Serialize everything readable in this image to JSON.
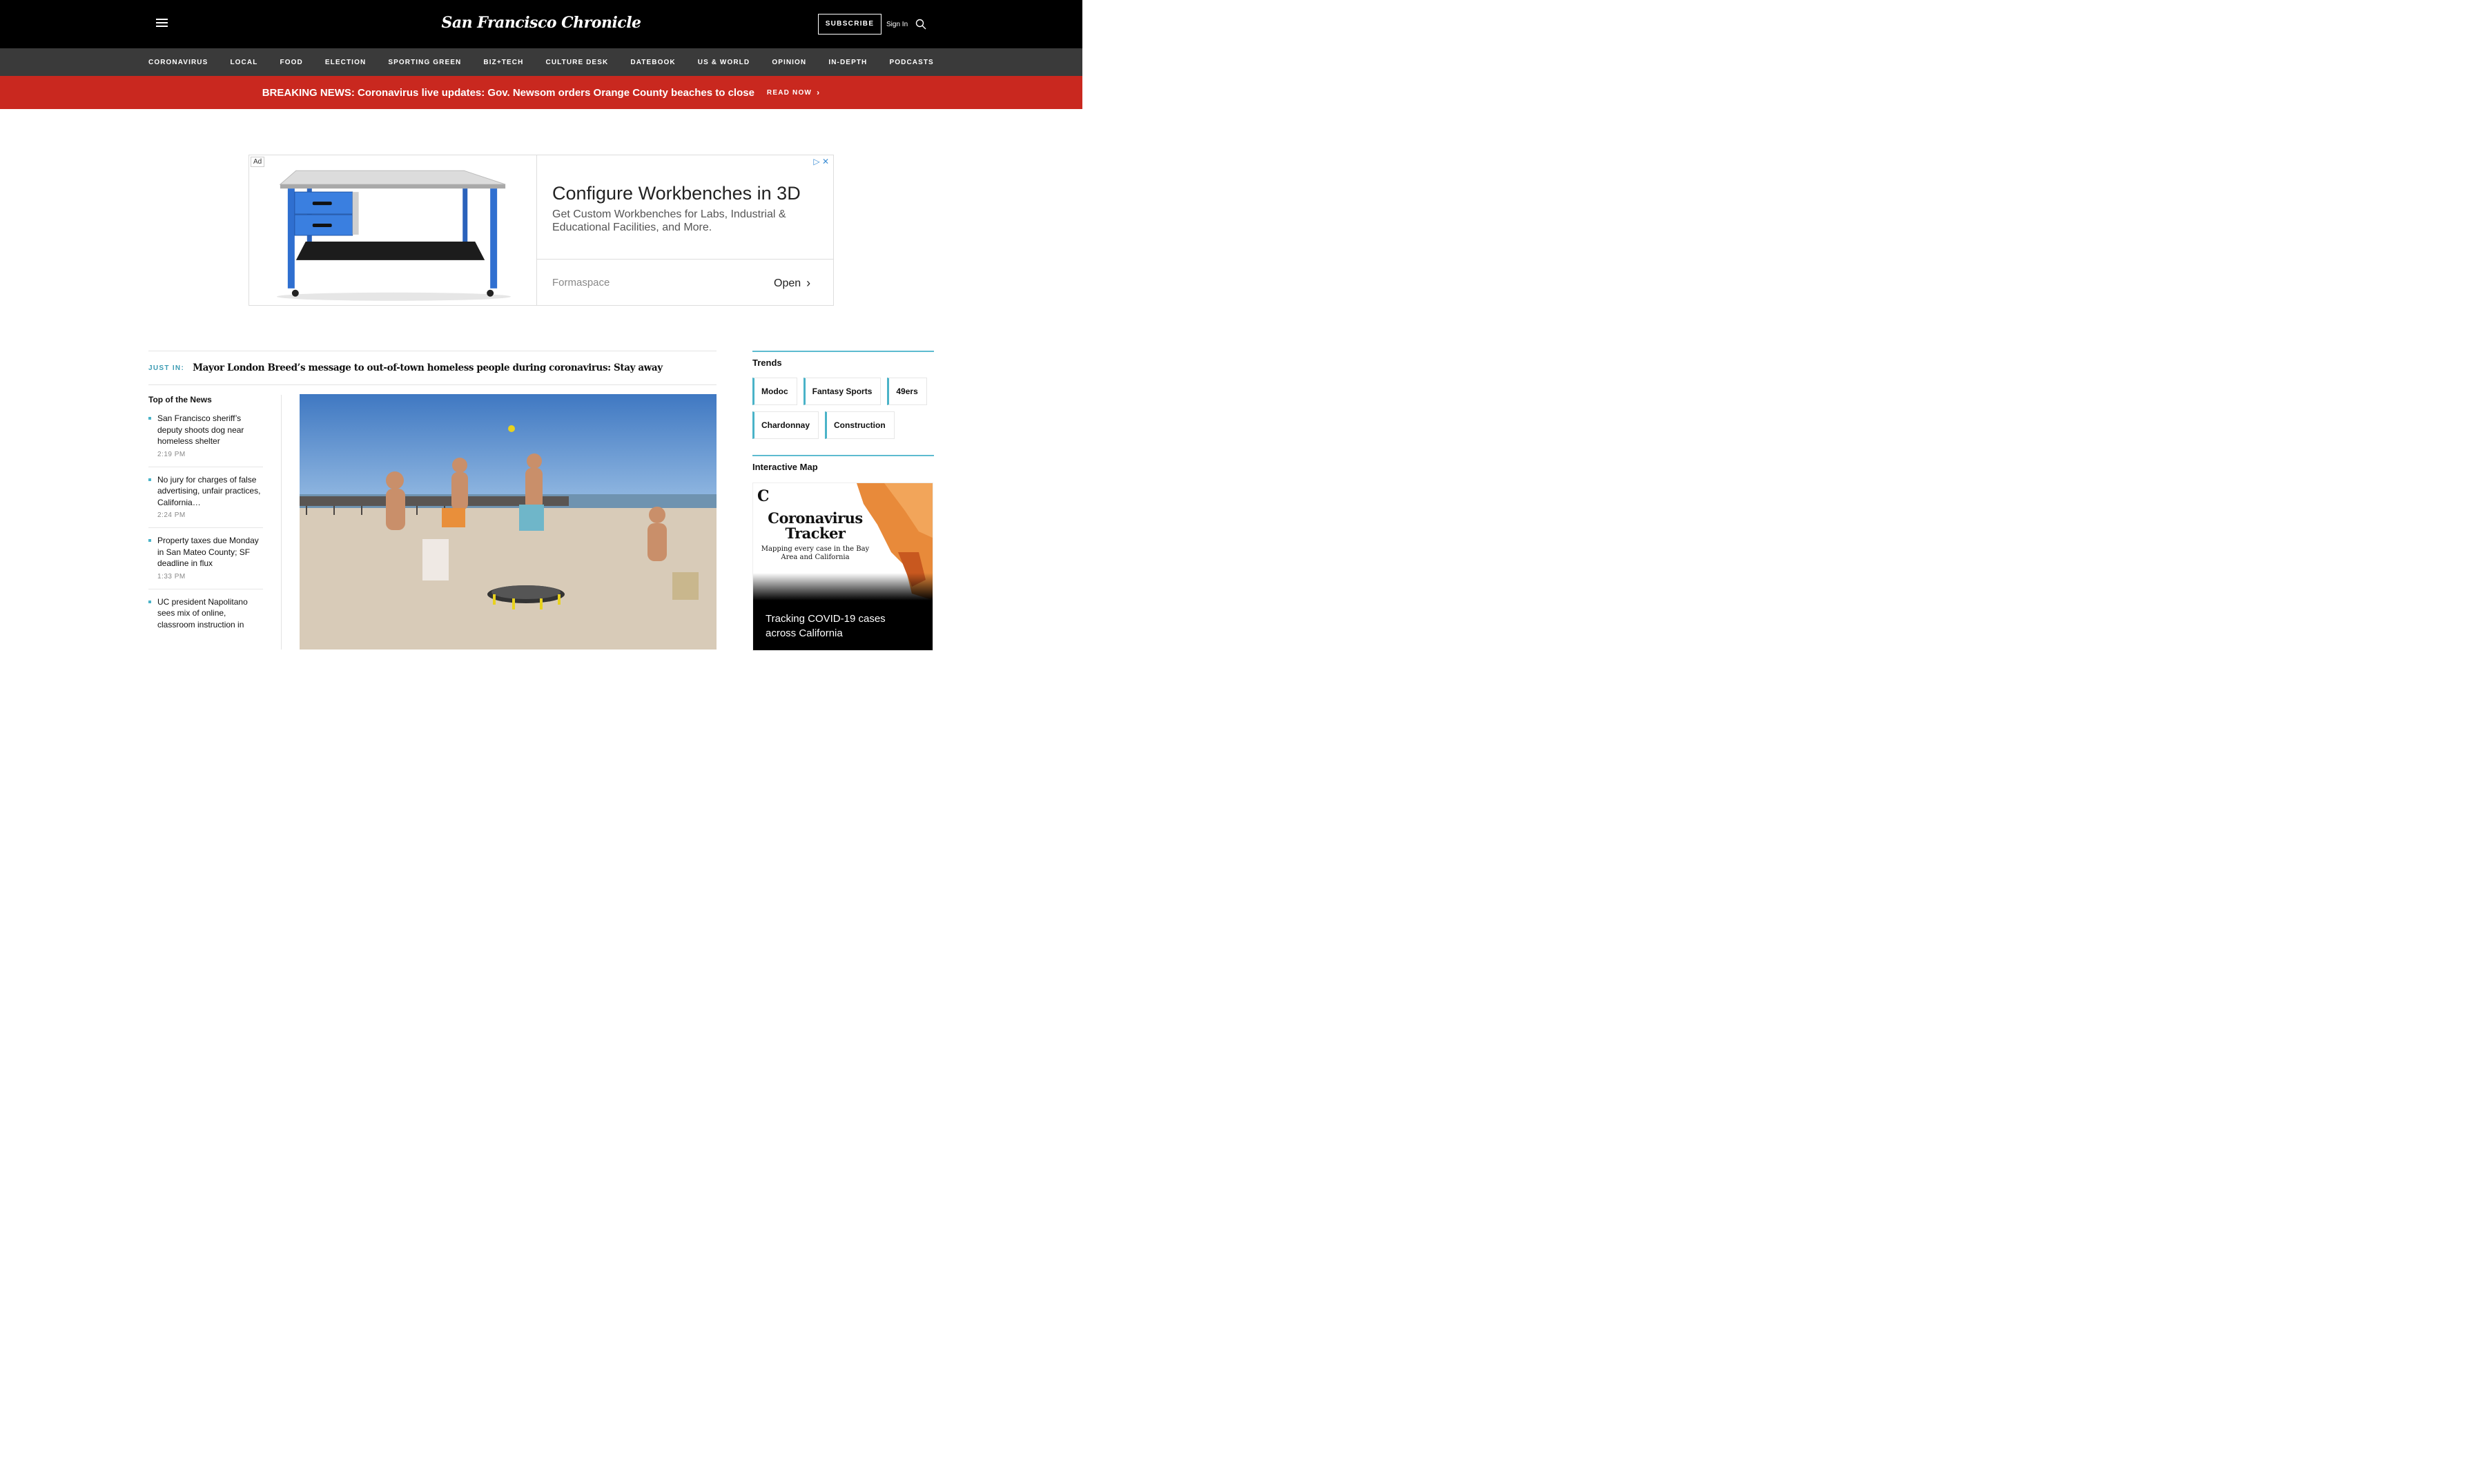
{
  "header": {
    "logo": "San Francisco Chronicle",
    "subscribe_label": "SUBSCRIBE",
    "signin_label": "Sign In",
    "icons": [
      "menu-icon",
      "search-icon"
    ]
  },
  "nav": {
    "items": [
      "CORONAVIRUS",
      "LOCAL",
      "FOOD",
      "ELECTION",
      "SPORTING GREEN",
      "BIZ+TECH",
      "CULTURE DESK",
      "DATEBOOK",
      "US & WORLD",
      "OPINION",
      "IN-DEPTH",
      "PODCASTS"
    ]
  },
  "breaking": {
    "headline": "BREAKING NEWS: Coronavirus live updates: Gov. Newsom orders Orange County beaches to close",
    "cta": "READ NOW"
  },
  "ad": {
    "badge": "Ad",
    "title": "Configure Workbenches in 3D",
    "description": "Get Custom Workbenches for Labs, Industrial & Educational Facilities, and More.",
    "brand": "Formaspace",
    "cta": "Open"
  },
  "just_in": {
    "label": "JUST IN:",
    "title": "Mayor London Breed’s message to out-of-town homeless people during coronavirus: Stay away"
  },
  "top_news": {
    "heading": "Top of the News",
    "items": [
      {
        "title": "San Francisco sheriff’s deputy shoots dog near homeless shelter",
        "time": "2:19 PM"
      },
      {
        "title": "No jury for charges of false advertising, unfair practices, California…",
        "time": "2:24 PM"
      },
      {
        "title": "Property taxes due Monday in San Mateo County; SF deadline in flux",
        "time": "1:33 PM"
      },
      {
        "title": "UC president Napolitano sees mix of online, classroom instruction in",
        "time": ""
      }
    ]
  },
  "trends": {
    "heading": "Trends",
    "items": [
      "Modoc",
      "Fantasy Sports",
      "49ers",
      "Chardonnay",
      "Construction"
    ]
  },
  "interactive_map": {
    "heading": "Interactive Map",
    "logo_letter": "C",
    "title": "Coronavirus Tracker",
    "subtitle": "Mapping every case in the Bay Area and California",
    "caption": "Tracking COVID-19 cases across California"
  },
  "colors": {
    "breaking_bg": "#c9281f",
    "accent": "#4ab3c8",
    "nav_bg": "#3a3a3a"
  }
}
